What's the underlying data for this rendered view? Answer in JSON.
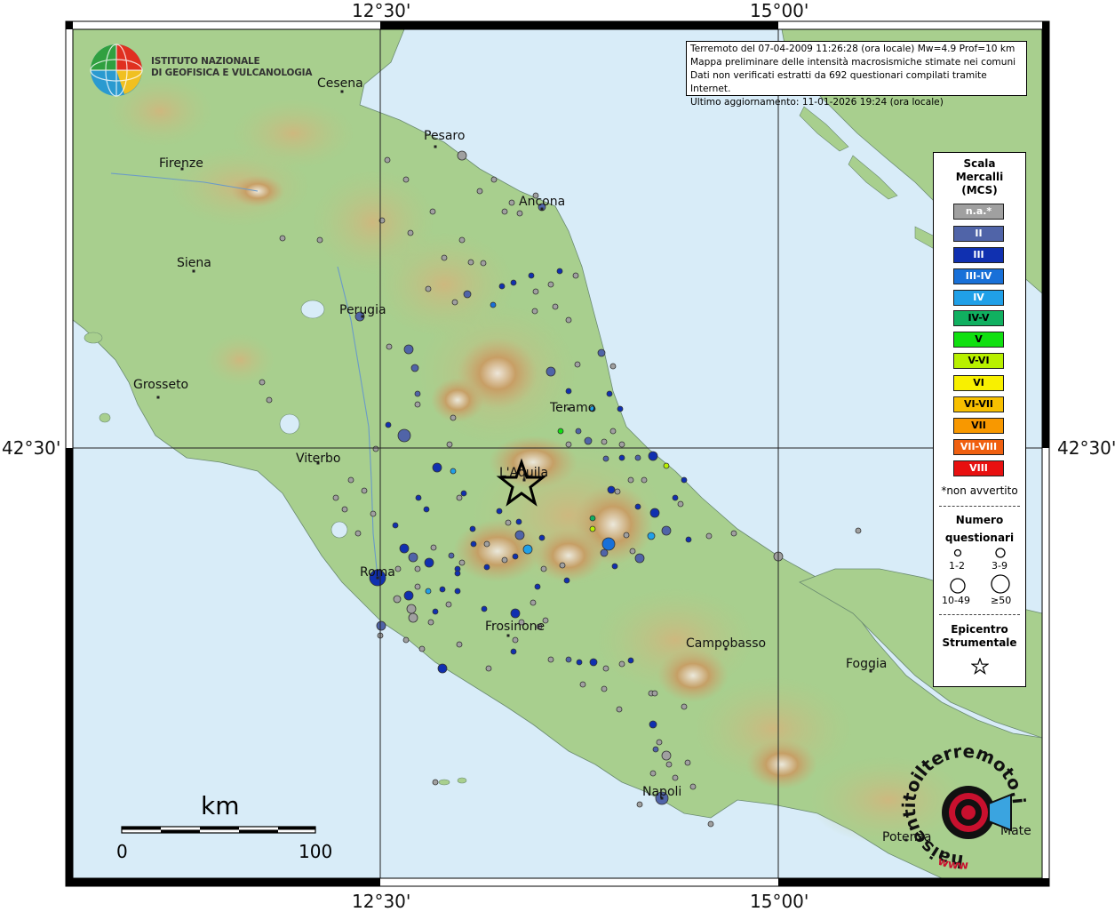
{
  "header": {
    "info_lines": [
      "Terremoto del 07-04-2009 11:26:28 (ora locale) Mw=4.9 Prof=10 km",
      "Mappa preliminare delle intensità macrosismiche stimate nei comuni",
      "Dati non verificati estratti da 692 questionari compilati tramite Internet.",
      "Ultimo aggiornamento: 11-01-2026 19:24 (ora locale)"
    ]
  },
  "institute": {
    "line1": "ISTITUTO NAZIONALE",
    "line2": "DI GEOFISICA E VULCANOLOGIA"
  },
  "graticule": {
    "lon_left": "12°30'",
    "lon_right": "15°00'",
    "lat": "42°30'"
  },
  "cities": [
    {
      "id": "cesena",
      "name": "Cesena"
    },
    {
      "id": "pesaro",
      "name": "Pesaro"
    },
    {
      "id": "firenze",
      "name": "Firenze"
    },
    {
      "id": "ancona",
      "name": "Ancona"
    },
    {
      "id": "siena",
      "name": "Siena"
    },
    {
      "id": "perugia",
      "name": "Perugia"
    },
    {
      "id": "grosseto",
      "name": "Grosseto"
    },
    {
      "id": "teramo",
      "name": "Teramo"
    },
    {
      "id": "viterbo",
      "name": "Viterbo"
    },
    {
      "id": "laquila",
      "name": "L'Aquila"
    },
    {
      "id": "roma",
      "name": "Roma"
    },
    {
      "id": "frosinone",
      "name": "Frosinone"
    },
    {
      "id": "campobasso",
      "name": "Campobasso"
    },
    {
      "id": "foggia",
      "name": "Foggia"
    },
    {
      "id": "napoli",
      "name": "Napoli"
    },
    {
      "id": "potenza",
      "name": "Potenza"
    },
    {
      "id": "matera",
      "name": "Mate"
    }
  ],
  "legend": {
    "title": [
      "Scala",
      "Mercalli",
      "(MCS)"
    ],
    "mcs": [
      {
        "label": "n.a.*",
        "color": "#a0a0a0",
        "text_color": "#ffffff"
      },
      {
        "label": "II",
        "color": "#5064a8",
        "text_color": "#ffffff"
      },
      {
        "label": "III",
        "color": "#1030b0",
        "text_color": "#ffffff"
      },
      {
        "label": "III-IV",
        "color": "#1870d8",
        "text_color": "#ffffff"
      },
      {
        "label": "IV",
        "color": "#20a0e8",
        "text_color": "#ffffff"
      },
      {
        "label": "IV-V",
        "color": "#10b060",
        "text_color": "#000000"
      },
      {
        "label": "V",
        "color": "#10e010",
        "text_color": "#000000"
      },
      {
        "label": "V-VI",
        "color": "#b8f000",
        "text_color": "#000000"
      },
      {
        "label": "VI",
        "color": "#f8f000",
        "text_color": "#000000"
      },
      {
        "label": "VI-VII",
        "color": "#f8c000",
        "text_color": "#000000"
      },
      {
        "label": "VII",
        "color": "#f89800",
        "text_color": "#000000"
      },
      {
        "label": "VII-VIII",
        "color": "#f06010",
        "text_color": "#ffffff"
      },
      {
        "label": "VIII",
        "color": "#e81010",
        "text_color": "#ffffff"
      }
    ],
    "not_felt": "*non avvertito",
    "count_title": [
      "Numero",
      "questionari"
    ],
    "count_classes": [
      "1-2",
      "3-9",
      "10-49",
      "≥50"
    ],
    "epicenter_title": [
      "Epicentro",
      "Strumentale"
    ]
  },
  "scalebar": {
    "unit": "km",
    "start": "0",
    "end": "100"
  },
  "watermark": {
    "text": "haisentitoilterremoto.it",
    "url_text": "www"
  },
  "colors": {
    "sea": "#d8ecf8",
    "land": "#a8cf8e",
    "highland": "#d8b880",
    "mountain": "#c89860",
    "frame": "#000000"
  }
}
